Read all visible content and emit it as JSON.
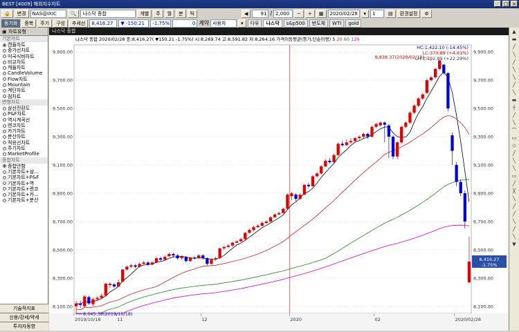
{
  "window": {
    "title": "BEST [4009] 해외지수차트",
    "controls": [
      "_",
      "□",
      "×"
    ]
  },
  "toolbar1": {
    "mode_label": "변경",
    "symbol": "NAS@IXIC",
    "symbol_name": "나스닥 종합",
    "period_buttons": [
      "개별",
      "주",
      "월",
      "분",
      "틱"
    ],
    "count": "91",
    "total": "2,000",
    "date": "2020/02/28",
    "multiplier": "1",
    "settings_label": "환경설정"
  },
  "toolbar2": {
    "buttons": [
      "동기화",
      "중복",
      "주기",
      "구성",
      "추세선"
    ],
    "price": "8,416.27",
    "change": "▼ -150.21",
    "change_pct": "-1.75%",
    "volume": "0",
    "volume_label": "계약",
    "user_select": "사용자",
    "tabs": [
      "다우",
      "나스닥",
      "s&p500",
      "반도체",
      "WTI",
      "gold"
    ],
    "active_tab": "나스닥"
  },
  "sidebar": {
    "header": "차트유형",
    "sections": [
      {
        "title": "기본차트",
        "items": [
          {
            "label": "캔들차트",
            "selected": true
          },
          {
            "label": "종가선차트",
            "selected": false
          },
          {
            "label": "미국식바차트",
            "selected": false
          },
          {
            "label": "비교차트",
            "selected": false
          },
          {
            "label": "캐들차트",
            "selected": false
          },
          {
            "label": "CandleVolume",
            "selected": false
          },
          {
            "label": "Flow차트",
            "selected": false
          },
          {
            "label": "Mountain",
            "selected": false
          },
          {
            "label": "계단차트",
            "selected": false
          },
          {
            "label": "점차트",
            "selected": false
          }
        ]
      },
      {
        "title": "변형차트",
        "items": [
          {
            "label": "삼선전환도",
            "selected": false
          },
          {
            "label": "P&F차트",
            "selected": false
          },
          {
            "label": "역시계곡선",
            "selected": false
          },
          {
            "label": "렌코차트",
            "selected": false
          },
          {
            "label": "카기차트",
            "selected": false
          },
          {
            "label": "분산차트",
            "selected": false
          },
          {
            "label": "적응선차트",
            "selected": false
          },
          {
            "label": "주기차트",
            "selected": false
          },
          {
            "label": "MarketProfile",
            "selected": false
          }
        ]
      },
      {
        "title": "종합차트",
        "items": [
          {
            "label": "종합안함",
            "selected": true
          },
          {
            "label": "기본차트+삼...",
            "selected": false
          },
          {
            "label": "기본차트+P&F",
            "selected": false
          },
          {
            "label": "기본차트+역",
            "selected": false
          },
          {
            "label": "기본차트+렌코",
            "selected": false
          },
          {
            "label": "기본차트+카...",
            "selected": false
          },
          {
            "label": "기본차트+분산",
            "selected": false
          }
        ]
      }
    ],
    "bottom_buttons": [
      "기술적지표",
      "신용/강세/약세",
      "투자자동향"
    ]
  },
  "chart_header": {
    "title": "나스닥 종합"
  },
  "chart_data": {
    "type": "candlestick",
    "title": "나스닥 종합",
    "info_line": "나스닥 종합 2020/02/28 종:8,416.27( ▼150.21 -1.75%) 시:8,269.74 고:8,591.82 저:8,264.16",
    "ma_label": "가격이동평균(종가,단순이평)",
    "ma_periods": [
      "5",
      "20",
      "60",
      "120"
    ],
    "hc": "HC:1,422.10 (-14.45%)",
    "lc": "LC:370.89 (+4.61%)",
    "lh": "LH:1,792.99 (+22.29%)",
    "ylim": [
      8050,
      9950
    ],
    "y_ticks": [
      "9,900.00",
      "9,700.00",
      "9,500.00",
      "9,300.00",
      "9,100.00",
      "8,900.00",
      "8,700.00",
      "8,500.00",
      "8,300.00",
      "8,100.00"
    ],
    "y_tick_values": [
      9900,
      9700,
      9500,
      9300,
      9100,
      8900,
      8700,
      8500,
      8300,
      8100
    ],
    "x_labels": [
      {
        "label": "2019/10/18",
        "index": 0
      },
      {
        "label": "11",
        "index": 10
      },
      {
        "label": "12",
        "index": 30
      },
      {
        "label": "2020",
        "index": 51
      },
      {
        "label": "02",
        "index": 71
      },
      {
        "label": "2020/02/28",
        "index": 90
      }
    ],
    "year_divider_index": 51,
    "high_annotation": {
      "label": "9,838.37(2020/02/19)",
      "value": 9838.37,
      "index": 84
    },
    "low_annotation": {
      "label": "8,045.38(2019/10/18)",
      "value": 8045.38,
      "index": 0
    },
    "last_price": "8,416.27",
    "last_change": "-1.75%",
    "last_value": 8416.27,
    "candles": [
      [
        8100,
        8120,
        8140,
        8045
      ],
      [
        8120,
        8110,
        8140,
        8090
      ],
      [
        8100,
        8170,
        8180,
        8095
      ],
      [
        8165,
        8120,
        8175,
        8110
      ],
      [
        8115,
        8150,
        8160,
        8100
      ],
      [
        8150,
        8160,
        8170,
        8140
      ],
      [
        8160,
        8175,
        8190,
        8150
      ],
      [
        8175,
        8260,
        8265,
        8170
      ],
      [
        8250,
        8260,
        8270,
        8230
      ],
      [
        8255,
        8240,
        8265,
        8230
      ],
      [
        8240,
        8270,
        8290,
        8235
      ],
      [
        8275,
        8360,
        8365,
        8270
      ],
      [
        8360,
        8380,
        8390,
        8350
      ],
      [
        8380,
        8390,
        8400,
        8370
      ],
      [
        8390,
        8380,
        8400,
        8370
      ],
      [
        8380,
        8400,
        8410,
        8375
      ],
      [
        8400,
        8410,
        8420,
        8395
      ],
      [
        8410,
        8395,
        8420,
        8385
      ],
      [
        8395,
        8410,
        8420,
        8390
      ],
      [
        8410,
        8440,
        8450,
        8405
      ],
      [
        8440,
        8430,
        8450,
        8420
      ],
      [
        8430,
        8450,
        8460,
        8425
      ],
      [
        8455,
        8470,
        8480,
        8450
      ],
      [
        8470,
        8460,
        8480,
        8445
      ],
      [
        8460,
        8440,
        8470,
        8430
      ],
      [
        8440,
        8450,
        8460,
        8430
      ],
      [
        8450,
        8420,
        8455,
        8410
      ],
      [
        8420,
        8445,
        8450,
        8415
      ],
      [
        8445,
        8440,
        8455,
        8430
      ],
      [
        8440,
        8460,
        8470,
        8435
      ],
      [
        8460,
        8440,
        8470,
        8430
      ],
      [
        8440,
        8400,
        8445,
        8390
      ],
      [
        8400,
        8430,
        8440,
        8395
      ],
      [
        8430,
        8440,
        8450,
        8420
      ],
      [
        8440,
        8510,
        8515,
        8435
      ],
      [
        8510,
        8520,
        8530,
        8500
      ],
      [
        8520,
        8530,
        8540,
        8510
      ],
      [
        8530,
        8550,
        8560,
        8520
      ],
      [
        8550,
        8560,
        8570,
        8545
      ],
      [
        8560,
        8575,
        8585,
        8555
      ],
      [
        8575,
        8620,
        8625,
        8570
      ],
      [
        8620,
        8640,
        8650,
        8615
      ],
      [
        8640,
        8660,
        8670,
        8630
      ],
      [
        8660,
        8670,
        8680,
        8655
      ],
      [
        8670,
        8690,
        8700,
        8665
      ],
      [
        8690,
        8700,
        8710,
        8685
      ],
      [
        8700,
        8730,
        8740,
        8695
      ],
      [
        8730,
        8750,
        8760,
        8725
      ],
      [
        8750,
        8760,
        8770,
        8745
      ],
      [
        8760,
        8790,
        8800,
        8755
      ],
      [
        8790,
        8890,
        8900,
        8785
      ],
      [
        8880,
        8900,
        8910,
        8850
      ],
      [
        8890,
        8860,
        8900,
        8845
      ],
      [
        8860,
        8890,
        8900,
        8850
      ],
      [
        8890,
        8960,
        8965,
        8885
      ],
      [
        8960,
        8950,
        8975,
        8935
      ],
      [
        8950,
        9020,
        9030,
        8945
      ],
      [
        9020,
        9040,
        9050,
        9010
      ],
      [
        9040,
        9090,
        9100,
        9030
      ],
      [
        9090,
        9130,
        9140,
        9085
      ],
      [
        9130,
        9120,
        9150,
        9110
      ],
      [
        9120,
        9170,
        9180,
        9115
      ],
      [
        9170,
        9250,
        9260,
        9165
      ],
      [
        9250,
        9240,
        9270,
        9230
      ],
      [
        9240,
        9260,
        9280,
        9235
      ],
      [
        9260,
        9270,
        9290,
        9250
      ],
      [
        9270,
        9290,
        9300,
        9260
      ],
      [
        9290,
        9300,
        9310,
        9270
      ],
      [
        9300,
        9320,
        9330,
        9290
      ],
      [
        9320,
        9300,
        9330,
        9285
      ],
      [
        9300,
        9370,
        9380,
        9295
      ],
      [
        9370,
        9390,
        9400,
        9360
      ],
      [
        9380,
        9400,
        9410,
        9370
      ],
      [
        9400,
        9385,
        9410,
        9260
      ],
      [
        9380,
        9300,
        9390,
        9150
      ],
      [
        9300,
        9160,
        9310,
        9140
      ],
      [
        9160,
        9260,
        9270,
        9140
      ],
      [
        9260,
        9370,
        9380,
        9250
      ],
      [
        9370,
        9400,
        9410,
        9360
      ],
      [
        9400,
        9470,
        9480,
        9390
      ],
      [
        9470,
        9520,
        9530,
        9460
      ],
      [
        9520,
        9570,
        9580,
        9510
      ],
      [
        9570,
        9600,
        9610,
        9560
      ],
      [
        9610,
        9700,
        9710,
        9600
      ],
      [
        9700,
        9720,
        9730,
        9690
      ],
      [
        9720,
        9780,
        9790,
        9710
      ],
      [
        9780,
        9840,
        9845,
        9770
      ],
      [
        9810,
        9750,
        9815,
        9740
      ],
      [
        9750,
        9500,
        9760,
        9480
      ],
      [
        9310,
        9200,
        9330,
        9100
      ],
      [
        9100,
        8980,
        9120,
        8950
      ],
      [
        8980,
        8900,
        9000,
        8880
      ],
      [
        8900,
        8700,
        8920,
        8650
      ],
      [
        8270,
        8416,
        8592,
        8264
      ]
    ]
  },
  "right_tools": [
    "▲",
    "▬",
    "╱",
    "╲",
    "╱",
    "╲",
    "╲",
    "╱",
    "╲",
    "▬",
    "┼",
    "╱",
    "╲",
    "⌒",
    "▭",
    "◇",
    "╱",
    "╲",
    "╲",
    "▭",
    "╱",
    "╳",
    "╲",
    "╱",
    "╱",
    "╲",
    "╱",
    "╲",
    "▼"
  ],
  "colors": {
    "up": "#e00000",
    "down": "#0000e0",
    "ma5": "#000000",
    "ma20": "#d02020",
    "ma60": "#208020",
    "ma120": "#d000d0"
  }
}
